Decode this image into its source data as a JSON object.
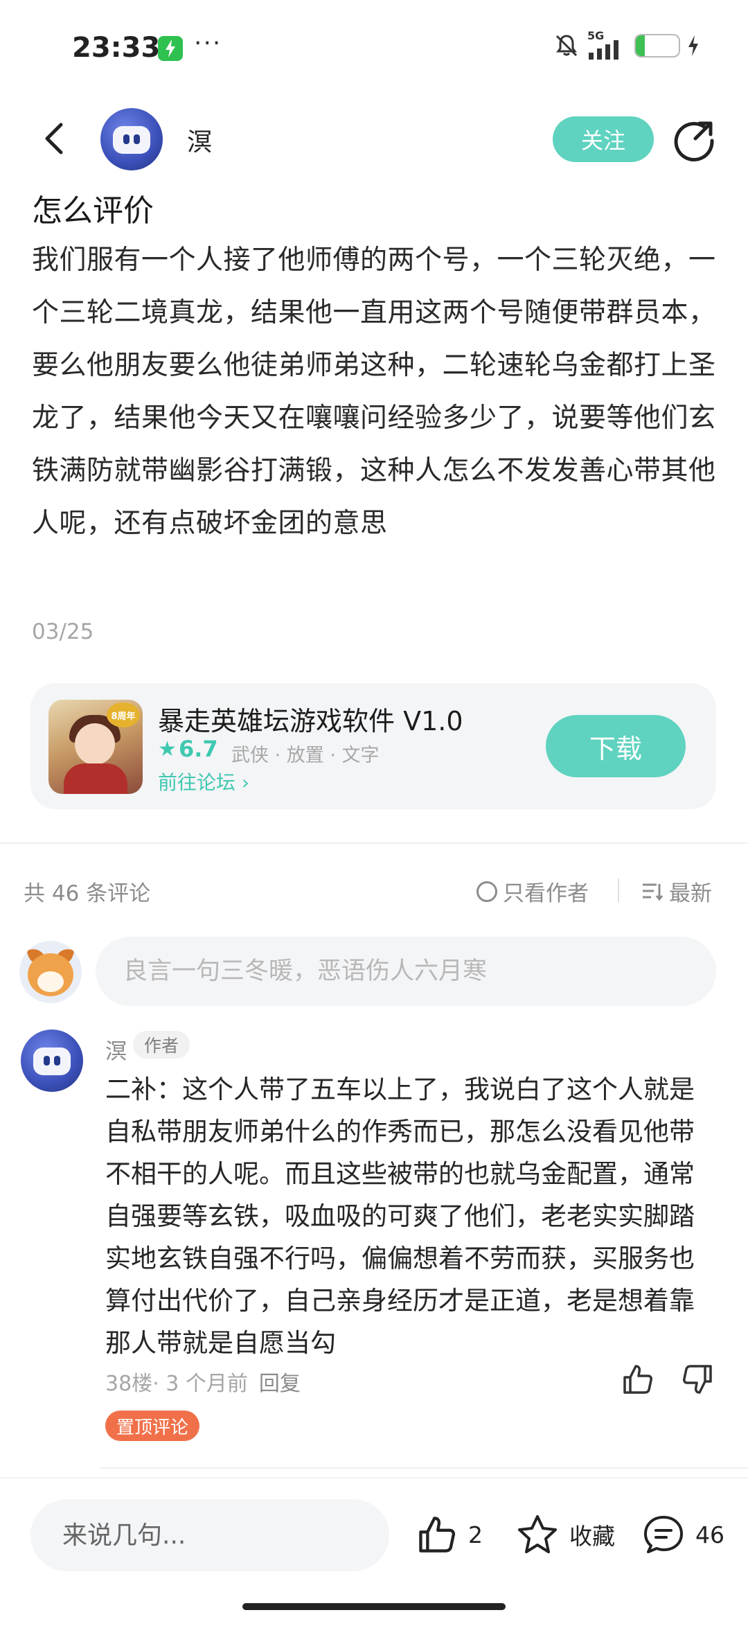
{
  "status_bar": {
    "time": "23:33",
    "dots": "···",
    "network": "5G",
    "battery_level": "21",
    "battery_percent": 21,
    "icons": [
      "charging-app-icon",
      "mute-bell-icon",
      "signal-icon",
      "battery-icon",
      "charging-bolt-icon"
    ]
  },
  "header": {
    "author_name": "溟",
    "follow_label": "关注"
  },
  "post": {
    "title": "怎么评价",
    "body": "我们服有一个人接了他师傅的两个号，一个三轮灭绝，一个三轮二境真龙，结果他一直用这两个号随便带群员本，要么他朋友要么他徒弟师弟这种，二轮速轮乌金都打上圣龙了，结果他今天又在嚷嚷问经验多少了，说要等他们玄铁满防就带幽影谷打满锻，这种人怎么不发发善心带其他人呢，还有点破坏金团的意思",
    "date": "03/25"
  },
  "app_card": {
    "icon_badge": "8周年",
    "name": "暴走英雄坛游戏软件 V1.0",
    "rating": "6.7",
    "tags": "武侠 · 放置 · 文字",
    "forum_link": "前往论坛 ›",
    "download_label": "下载"
  },
  "comments_header": {
    "count_text": "共 46 条评论",
    "only_author": "只看作者",
    "sort": "最新"
  },
  "comment_input": {
    "placeholder": "良言一句三冬暖，恶语伤人六月寒"
  },
  "comment": {
    "name": "溟",
    "author_tag": "作者",
    "body": "二补：这个人带了五车以上了，我说白了这个人就是自私带朋友师弟什么的作秀而已，那怎么没看见他带不相干的人呢。而且这些被带的也就乌金配置，通常自强要等玄铁，吸血吸的可爽了他们，老老实实脚踏实地玄铁自强不行吗，偏偏想着不劳而获，买服务也算付出代价了，自己亲身经历才是正道，老是想着靠那人带就是自愿当勾",
    "floor": "38楼",
    "time": " · 3 个月前",
    "reply": "回复",
    "pin_tag": "置顶评论"
  },
  "bottom_bar": {
    "say_placeholder": "来说几句...",
    "like_count": "2",
    "fav_label": "收藏",
    "comment_count": "46"
  },
  "colors": {
    "accent": "#5fd3bf",
    "accent_text": "#3fc8b0",
    "pin": "#f0704a",
    "muted": "#8c8c8c"
  }
}
